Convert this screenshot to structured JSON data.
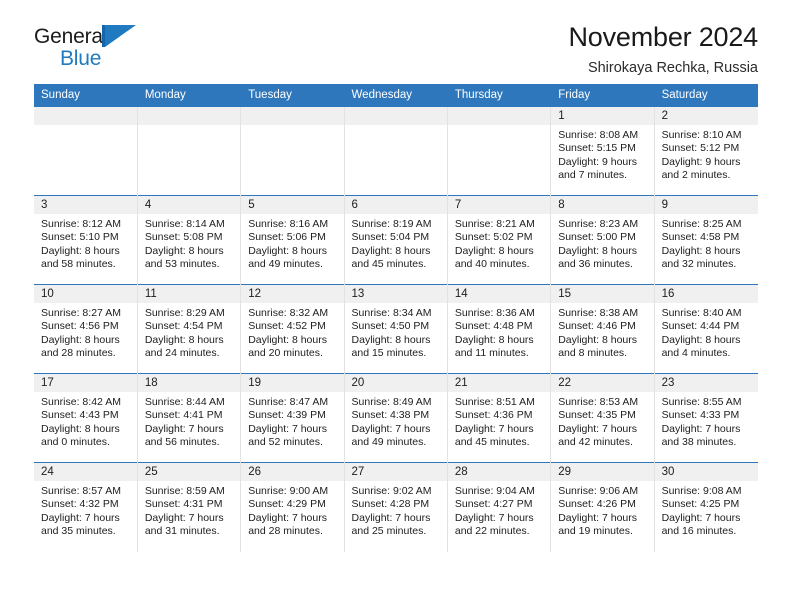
{
  "brand": {
    "name_part1": "General",
    "name_part2": "Blue",
    "mark": "triangle-flag-icon"
  },
  "header": {
    "title": "November 2024",
    "subtitle": "Shirokaya Rechka, Russia"
  },
  "colors": {
    "header_blue": "#2e77bc",
    "brand_blue": "#1f7ac0",
    "daynum_band": "#f0f0f0",
    "cell_border": "#e2e2e2",
    "text": "#1d1d1d"
  },
  "weekday_headers": [
    "Sunday",
    "Monday",
    "Tuesday",
    "Wednesday",
    "Thursday",
    "Friday",
    "Saturday"
  ],
  "labels": {
    "sunrise_prefix": "Sunrise:",
    "sunset_prefix": "Sunset:",
    "daylight_prefix": "Daylight:"
  },
  "weeks": [
    [
      {
        "empty": true
      },
      {
        "empty": true
      },
      {
        "empty": true
      },
      {
        "empty": true
      },
      {
        "empty": true
      },
      {
        "day": "1",
        "sunrise": "Sunrise: 8:08 AM",
        "sunset": "Sunset: 5:15 PM",
        "daylight_line1": "Daylight: 9 hours",
        "daylight_line2": "and 7 minutes."
      },
      {
        "day": "2",
        "sunrise": "Sunrise: 8:10 AM",
        "sunset": "Sunset: 5:12 PM",
        "daylight_line1": "Daylight: 9 hours",
        "daylight_line2": "and 2 minutes."
      }
    ],
    [
      {
        "day": "3",
        "sunrise": "Sunrise: 8:12 AM",
        "sunset": "Sunset: 5:10 PM",
        "daylight_line1": "Daylight: 8 hours",
        "daylight_line2": "and 58 minutes."
      },
      {
        "day": "4",
        "sunrise": "Sunrise: 8:14 AM",
        "sunset": "Sunset: 5:08 PM",
        "daylight_line1": "Daylight: 8 hours",
        "daylight_line2": "and 53 minutes."
      },
      {
        "day": "5",
        "sunrise": "Sunrise: 8:16 AM",
        "sunset": "Sunset: 5:06 PM",
        "daylight_line1": "Daylight: 8 hours",
        "daylight_line2": "and 49 minutes."
      },
      {
        "day": "6",
        "sunrise": "Sunrise: 8:19 AM",
        "sunset": "Sunset: 5:04 PM",
        "daylight_line1": "Daylight: 8 hours",
        "daylight_line2": "and 45 minutes."
      },
      {
        "day": "7",
        "sunrise": "Sunrise: 8:21 AM",
        "sunset": "Sunset: 5:02 PM",
        "daylight_line1": "Daylight: 8 hours",
        "daylight_line2": "and 40 minutes."
      },
      {
        "day": "8",
        "sunrise": "Sunrise: 8:23 AM",
        "sunset": "Sunset: 5:00 PM",
        "daylight_line1": "Daylight: 8 hours",
        "daylight_line2": "and 36 minutes."
      },
      {
        "day": "9",
        "sunrise": "Sunrise: 8:25 AM",
        "sunset": "Sunset: 4:58 PM",
        "daylight_line1": "Daylight: 8 hours",
        "daylight_line2": "and 32 minutes."
      }
    ],
    [
      {
        "day": "10",
        "sunrise": "Sunrise: 8:27 AM",
        "sunset": "Sunset: 4:56 PM",
        "daylight_line1": "Daylight: 8 hours",
        "daylight_line2": "and 28 minutes."
      },
      {
        "day": "11",
        "sunrise": "Sunrise: 8:29 AM",
        "sunset": "Sunset: 4:54 PM",
        "daylight_line1": "Daylight: 8 hours",
        "daylight_line2": "and 24 minutes."
      },
      {
        "day": "12",
        "sunrise": "Sunrise: 8:32 AM",
        "sunset": "Sunset: 4:52 PM",
        "daylight_line1": "Daylight: 8 hours",
        "daylight_line2": "and 20 minutes."
      },
      {
        "day": "13",
        "sunrise": "Sunrise: 8:34 AM",
        "sunset": "Sunset: 4:50 PM",
        "daylight_line1": "Daylight: 8 hours",
        "daylight_line2": "and 15 minutes."
      },
      {
        "day": "14",
        "sunrise": "Sunrise: 8:36 AM",
        "sunset": "Sunset: 4:48 PM",
        "daylight_line1": "Daylight: 8 hours",
        "daylight_line2": "and 11 minutes."
      },
      {
        "day": "15",
        "sunrise": "Sunrise: 8:38 AM",
        "sunset": "Sunset: 4:46 PM",
        "daylight_line1": "Daylight: 8 hours",
        "daylight_line2": "and 8 minutes."
      },
      {
        "day": "16",
        "sunrise": "Sunrise: 8:40 AM",
        "sunset": "Sunset: 4:44 PM",
        "daylight_line1": "Daylight: 8 hours",
        "daylight_line2": "and 4 minutes."
      }
    ],
    [
      {
        "day": "17",
        "sunrise": "Sunrise: 8:42 AM",
        "sunset": "Sunset: 4:43 PM",
        "daylight_line1": "Daylight: 8 hours",
        "daylight_line2": "and 0 minutes."
      },
      {
        "day": "18",
        "sunrise": "Sunrise: 8:44 AM",
        "sunset": "Sunset: 4:41 PM",
        "daylight_line1": "Daylight: 7 hours",
        "daylight_line2": "and 56 minutes."
      },
      {
        "day": "19",
        "sunrise": "Sunrise: 8:47 AM",
        "sunset": "Sunset: 4:39 PM",
        "daylight_line1": "Daylight: 7 hours",
        "daylight_line2": "and 52 minutes."
      },
      {
        "day": "20",
        "sunrise": "Sunrise: 8:49 AM",
        "sunset": "Sunset: 4:38 PM",
        "daylight_line1": "Daylight: 7 hours",
        "daylight_line2": "and 49 minutes."
      },
      {
        "day": "21",
        "sunrise": "Sunrise: 8:51 AM",
        "sunset": "Sunset: 4:36 PM",
        "daylight_line1": "Daylight: 7 hours",
        "daylight_line2": "and 45 minutes."
      },
      {
        "day": "22",
        "sunrise": "Sunrise: 8:53 AM",
        "sunset": "Sunset: 4:35 PM",
        "daylight_line1": "Daylight: 7 hours",
        "daylight_line2": "and 42 minutes."
      },
      {
        "day": "23",
        "sunrise": "Sunrise: 8:55 AM",
        "sunset": "Sunset: 4:33 PM",
        "daylight_line1": "Daylight: 7 hours",
        "daylight_line2": "and 38 minutes."
      }
    ],
    [
      {
        "day": "24",
        "sunrise": "Sunrise: 8:57 AM",
        "sunset": "Sunset: 4:32 PM",
        "daylight_line1": "Daylight: 7 hours",
        "daylight_line2": "and 35 minutes."
      },
      {
        "day": "25",
        "sunrise": "Sunrise: 8:59 AM",
        "sunset": "Sunset: 4:31 PM",
        "daylight_line1": "Daylight: 7 hours",
        "daylight_line2": "and 31 minutes."
      },
      {
        "day": "26",
        "sunrise": "Sunrise: 9:00 AM",
        "sunset": "Sunset: 4:29 PM",
        "daylight_line1": "Daylight: 7 hours",
        "daylight_line2": "and 28 minutes."
      },
      {
        "day": "27",
        "sunrise": "Sunrise: 9:02 AM",
        "sunset": "Sunset: 4:28 PM",
        "daylight_line1": "Daylight: 7 hours",
        "daylight_line2": "and 25 minutes."
      },
      {
        "day": "28",
        "sunrise": "Sunrise: 9:04 AM",
        "sunset": "Sunset: 4:27 PM",
        "daylight_line1": "Daylight: 7 hours",
        "daylight_line2": "and 22 minutes."
      },
      {
        "day": "29",
        "sunrise": "Sunrise: 9:06 AM",
        "sunset": "Sunset: 4:26 PM",
        "daylight_line1": "Daylight: 7 hours",
        "daylight_line2": "and 19 minutes."
      },
      {
        "day": "30",
        "sunrise": "Sunrise: 9:08 AM",
        "sunset": "Sunset: 4:25 PM",
        "daylight_line1": "Daylight: 7 hours",
        "daylight_line2": "and 16 minutes."
      }
    ]
  ]
}
